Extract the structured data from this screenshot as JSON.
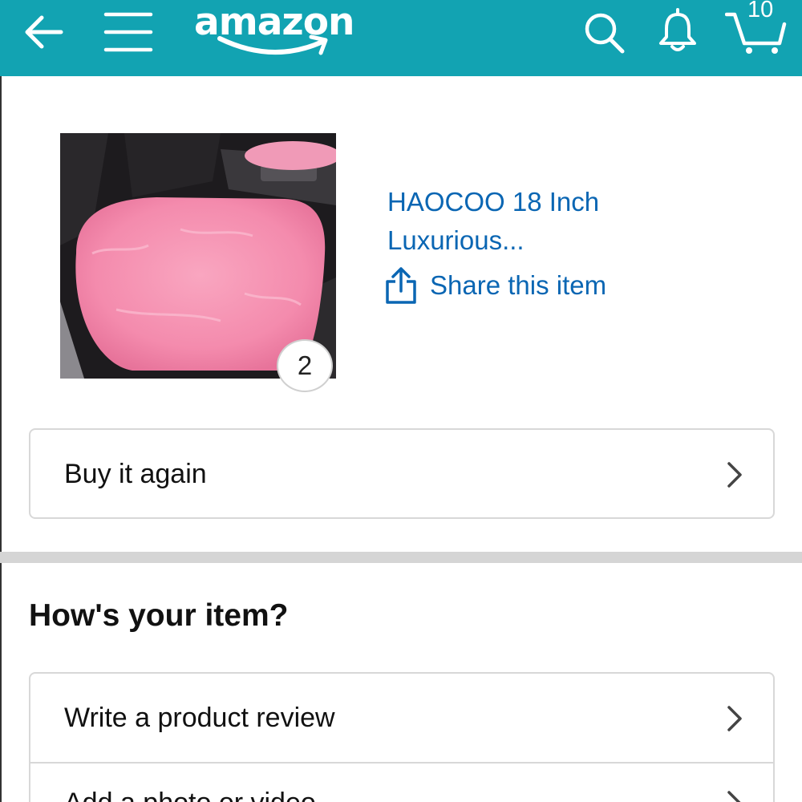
{
  "header": {
    "logo_text": "amazon",
    "cart_count": "10",
    "icons": [
      "back-arrow-icon",
      "hamburger-menu-icon",
      "search-icon",
      "bell-icon",
      "cart-icon"
    ],
    "bar_color": "#12a3b2"
  },
  "product": {
    "title_line1": "HAOCOO 18 Inch",
    "title_line2": "Luxurious...",
    "quantity": "2",
    "share_label": "Share this item",
    "link_color": "#0a66b3"
  },
  "actions": {
    "buy_again_label": "Buy it again"
  },
  "review_section": {
    "heading": "How's your item?",
    "items": [
      {
        "label": "Write a product review"
      },
      {
        "label": "Add a photo or video"
      }
    ]
  }
}
